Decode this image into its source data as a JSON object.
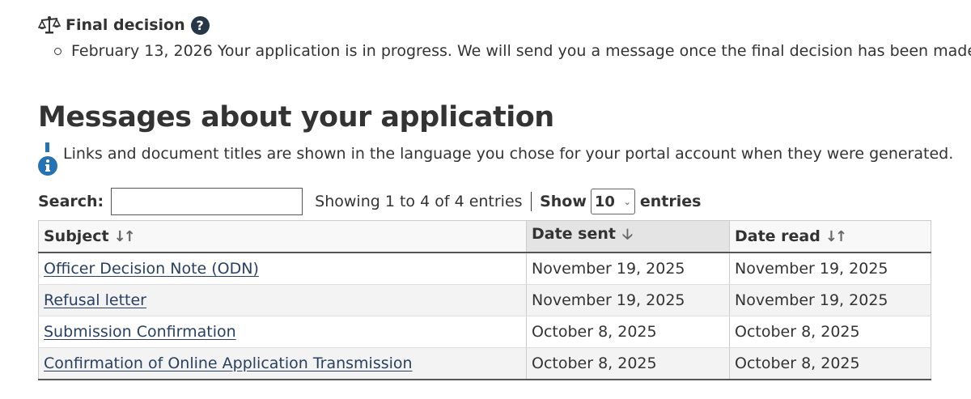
{
  "final_decision": {
    "label": "Final decision",
    "help_icon_glyph": "?",
    "date": "February 13, 2026",
    "status_text": "Your application is in progress. We will send you a message once the final decision has been made."
  },
  "messages": {
    "heading": "Messages about your application",
    "info_note": "Links and document titles are shown in the language you chose for your portal account when they were generated.",
    "search": {
      "label": "Search:",
      "value": "",
      "placeholder": ""
    },
    "showing_text": "Showing 1 to 4 of 4 entries",
    "show_label": "Show",
    "page_size": "10",
    "entries_label": "entries",
    "columns": {
      "subject": "Subject",
      "date_sent": "Date sent",
      "date_read": "Date read"
    },
    "rows": [
      {
        "subject": "Officer Decision Note (ODN)",
        "date_sent": "November 19, 2025",
        "date_read": "November 19, 2025"
      },
      {
        "subject": "Refusal letter",
        "date_sent": "November 19, 2025",
        "date_read": "November 19, 2025"
      },
      {
        "subject": "Submission Confirmation",
        "date_sent": "October 8, 2025",
        "date_read": "October 8, 2025"
      },
      {
        "subject": "Confirmation of Online Application Transmission",
        "date_sent": "October 8, 2025",
        "date_read": "October 8, 2025"
      }
    ]
  },
  "icons": {
    "scales": "scales-icon",
    "help": "help-icon",
    "info": "info-icon",
    "sort": "sort-icon",
    "sort_desc": "sort-desc-icon",
    "chevron": "chevron-down-icon"
  },
  "colors": {
    "text": "#333333",
    "link": "#284162",
    "help_icon_bg": "#26374a",
    "info_icon": "#2572b4",
    "sorted_header_bg": "#e4e4e4",
    "striped_row_bg": "#f3f3f3"
  }
}
